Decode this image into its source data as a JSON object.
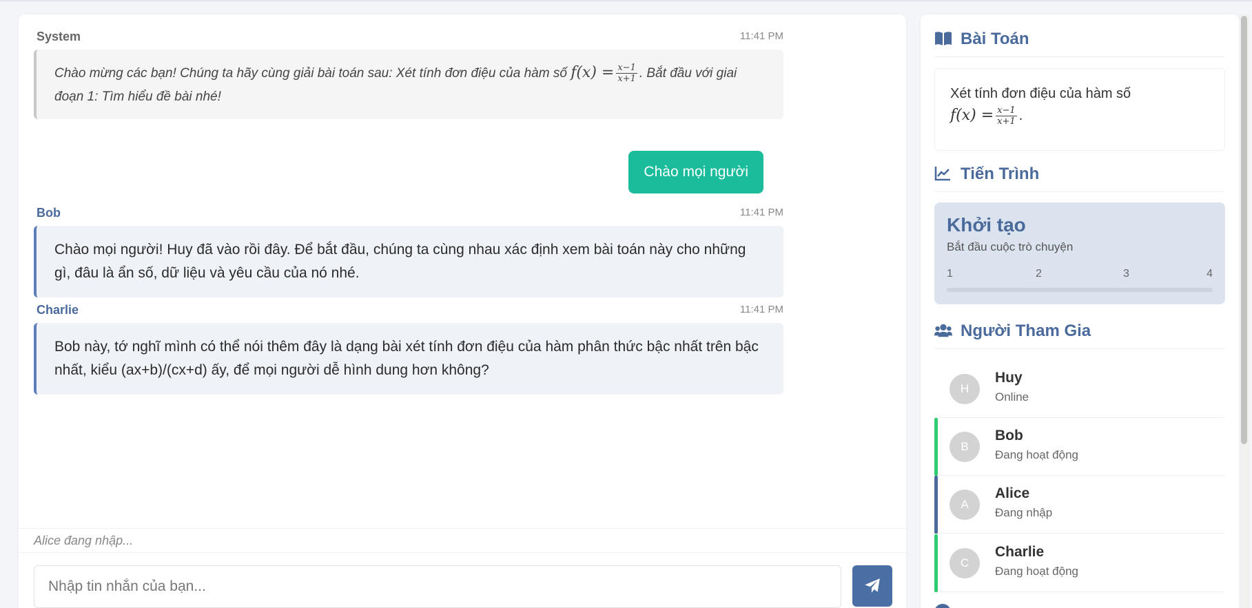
{
  "chat": {
    "messages": [
      {
        "sender": "System",
        "time": "11:41 PM",
        "text_before": "Chào mừng các bạn! Chúng ta hãy cùng giải bài toán sau: Xét tính đơn điệu của hàm số ",
        "math_fn": "f(x) =",
        "frac_num": "x−1",
        "frac_den": "x+1",
        "text_after": ". Bắt đầu với giai đoạn 1: Tìm hiểu đề bài nhé!"
      },
      {
        "sender": "Bob",
        "time": "11:41 PM",
        "text": "Chào mọi người! Huy đã vào rồi đây. Để bắt đầu, chúng ta cùng nhau xác định xem bài toán này cho những gì, đâu là ẩn số, dữ liệu và yêu cầu của nó nhé."
      },
      {
        "sender": "Charlie",
        "time": "11:41 PM",
        "text": "Bob này, tớ nghĩ mình có thể nói thêm đây là dạng bài xét tính đơn điệu của hàm phân thức bậc nhất trên bậc nhất, kiểu (ax+b)/(cx+d) ấy, để mọi người dễ hình dung hơn không?"
      }
    ],
    "own_message": "Chào mọi người",
    "typing_indicator": "Alice đang nhập...",
    "input_placeholder": "Nhập tin nhắn của bạn...",
    "send_icon": "paper-plane-icon"
  },
  "sidebar": {
    "problem": {
      "title": "Bài Toán",
      "icon": "book-icon",
      "text": "Xét tính đơn điệu của hàm số",
      "math_fn": "f(x) =",
      "frac_num": "x−1",
      "frac_den": "x+1",
      "end": "."
    },
    "progress": {
      "title": "Tiến Trình",
      "icon": "chart-line-icon",
      "stage": "Khởi tạo",
      "description": "Bắt đầu cuộc trò chuyện",
      "steps": [
        "1",
        "2",
        "3",
        "4"
      ],
      "fraction": 0
    },
    "participants": {
      "title": "Người Tham Gia",
      "icon": "users-icon",
      "list": [
        {
          "initial": "H",
          "name": "Huy",
          "status": "Online",
          "accent": ""
        },
        {
          "initial": "B",
          "name": "Bob",
          "status": "Đang hoạt động",
          "accent": "#2ecc71"
        },
        {
          "initial": "A",
          "name": "Alice",
          "status": "Đang nhập",
          "accent": "#4a6a9c"
        },
        {
          "initial": "C",
          "name": "Charlie",
          "status": "Đang hoạt động",
          "accent": "#2ecc71"
        }
      ]
    },
    "next_section_icon": "info-circle-icon"
  },
  "colors": {
    "accent": "#4a6a9c",
    "own_bubble": "#1abc9c",
    "active": "#2ecc71"
  }
}
